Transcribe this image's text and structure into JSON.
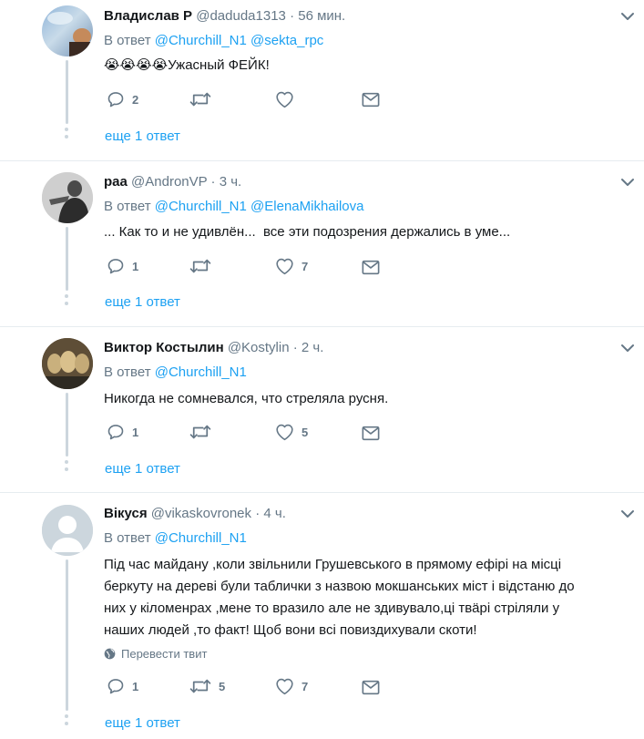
{
  "tweets": [
    {
      "name": "Владислав Р",
      "handle": "@daduda1313",
      "time": "· 56 мин.",
      "reply_prefix": "В ответ",
      "mentions": [
        "@Churchill_N1",
        "@sekta_rpc"
      ],
      "emoji": [
        "😭",
        "😭",
        "😭",
        "😭"
      ],
      "text": "Ужасный ФЕЙК!",
      "replies": "2",
      "retweets": "",
      "likes": "",
      "more": "еще 1 ответ"
    },
    {
      "name": "раа",
      "handle": "@AndronVP",
      "time": "· 3 ч.",
      "reply_prefix": "В ответ",
      "mentions": [
        "@Churchill_N1",
        "@ElenaMikhailova"
      ],
      "text": "... Как то и не удивлён...  все эти подозрения держались в уме...",
      "replies": "1",
      "retweets": "",
      "likes": "7",
      "more": "еще 1 ответ"
    },
    {
      "name": "Виктор Костылин",
      "handle": "@Kostylin",
      "time": "· 2 ч.",
      "reply_prefix": "В ответ",
      "mentions": [
        "@Churchill_N1"
      ],
      "text": "Никогда не сомневался, что стреляла русня.",
      "replies": "1",
      "retweets": "",
      "likes": "5",
      "more": "еще 1 ответ"
    },
    {
      "name": "Вікуся",
      "handle": "@vikaskovronek",
      "time": "· 4 ч.",
      "reply_prefix": "В ответ",
      "mentions": [
        "@Churchill_N1"
      ],
      "text_lines": [
        "Під час майдану ,коли звільнили Грушевського в прямому ефірі на місці",
        "беркуту на дереві були таблички з назвою мокшанських міст і відстаню до",
        "них у кіломенрах ,мене то вразило але не здивувало,ці твäрі стріляли у",
        "наших людей ,то факт! Щоб вони всі повиздихували скоти!"
      ],
      "translate": "Перевести твит",
      "replies": "1",
      "retweets": "5",
      "likes": "7",
      "more": "еще 1 ответ"
    }
  ],
  "colors": {
    "link": "#1da1f2",
    "secondary": "#657786",
    "text": "#14171a",
    "line": "#ccd6dd"
  },
  "icons": [
    "reply-icon",
    "retweet-icon",
    "like-icon",
    "message-icon",
    "caret-down-icon",
    "globe-icon"
  ]
}
